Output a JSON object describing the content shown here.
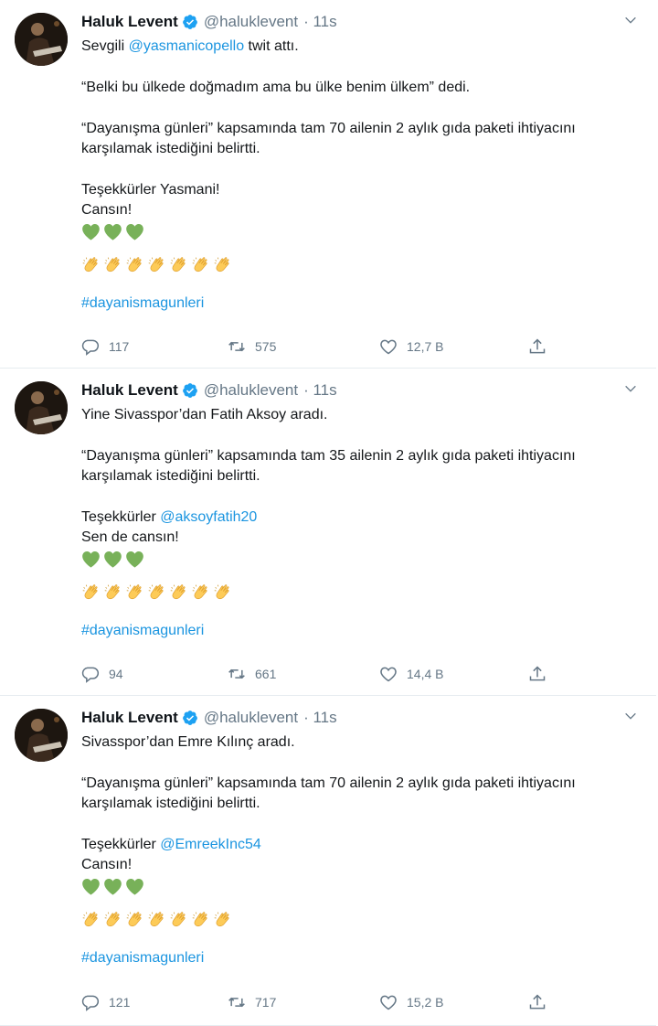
{
  "tweets": [
    {
      "name": "Haluk Levent",
      "handle": "@haluklevent",
      "time": "· 11s",
      "line1_pre": "Sevgili ",
      "line1_mention": "@yasmanicopello",
      "line1_post": " twit attı.",
      "quote": "“Belki bu ülkede doğmadım ama bu ülke benim ülkem” dedi.",
      "para": "“Dayanışma günleri” kapsamında tam 70 ailenin 2 aylık gıda paketi ihtiyacını karşılamak istediğini belirtti.",
      "thanks_pre": "Teşekkürler Yasmani!",
      "thanks_mention": "",
      "closing": "Cansın!",
      "hashtag": "#dayanismagunleri",
      "replies": "117",
      "retweets": "575",
      "likes": "12,7 B"
    },
    {
      "name": "Haluk Levent",
      "handle": "@haluklevent",
      "time": "· 11s",
      "line1": "Yine Sivasspor’dan Fatih Aksoy aradı.",
      "para": "“Dayanışma günleri” kapsamında tam 35 ailenin 2 aylık gıda paketi ihtiyacını karşılamak istediğini belirtti.",
      "thanks_pre": "Teşekkürler ",
      "thanks_mention": "@aksoyfatih20",
      "closing": "Sen de cansın!",
      "hashtag": "#dayanismagunleri",
      "replies": "94",
      "retweets": "661",
      "likes": "14,4 B"
    },
    {
      "name": "Haluk Levent",
      "handle": "@haluklevent",
      "time": "· 11s",
      "line1": "Sivasspor’dan Emre Kılınç aradı.",
      "para": "“Dayanışma günleri” kapsamında tam 70 ailenin 2 aylık gıda paketi ihtiyacını karşılamak istediğini belirtti.",
      "thanks_pre": "Teşekkürler ",
      "thanks_mention": "@EmreekInc54",
      "closing": "Cansın!",
      "hashtag": "#dayanismagunleri",
      "replies": "121",
      "retweets": "717",
      "likes": "15,2 B"
    }
  ],
  "icons": {
    "verified": "verified-badge-icon",
    "caret": "chevron-down-icon",
    "reply": "reply-icon",
    "retweet": "retweet-icon",
    "like": "heart-outline-icon",
    "share": "share-icon",
    "emoji_heart": "green-heart-emoji",
    "emoji_clap": "clapping-hands-emoji"
  },
  "colors": {
    "link": "#1b95e0",
    "verified": "#1da1f2",
    "muted": "#657786",
    "green_heart": "#78b159",
    "clap": "#fdcb58"
  }
}
